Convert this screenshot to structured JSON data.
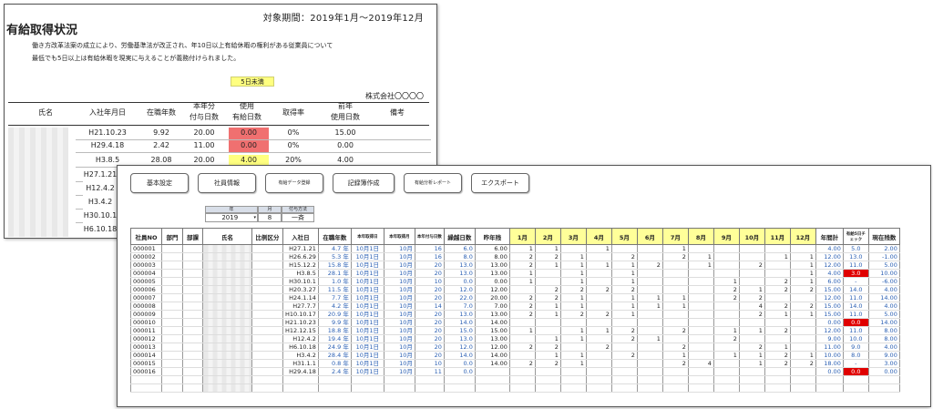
{
  "back_sheet": {
    "period": "対象期間：2019年1月～2019年12月",
    "title": "有給取得状況",
    "notice1": "働き方改革法案の成立により、労働基準法が改正され、年10日以上有給休暇の権利がある従業員について",
    "notice2": "最低でも5日以上は有給休暇を現実に与えることが義務付けられました。",
    "legend": "5日未満",
    "company": "株式会社〇〇〇〇",
    "headers": {
      "name": "氏名",
      "hire": "入社年月日",
      "tenure": "在職年数",
      "grant1": "本年分",
      "grant2": "付与日数",
      "used1": "使用",
      "used2": "有給日数",
      "rate": "取得率",
      "prev1": "前年",
      "prev2": "使用日数",
      "remarks": "備考"
    },
    "rows": [
      {
        "hire": "H21.10.23",
        "tenure": "9.92",
        "grant": "20.00",
        "used": "0.00",
        "rate": "0%",
        "prev": "15.00"
      },
      {
        "hire": "H29.4.18",
        "tenure": "2.42",
        "grant": "11.00",
        "used": "0.00",
        "rate": "0%",
        "prev": "0.00"
      },
      {
        "hire": "H3.8.5",
        "tenure": "28.08",
        "grant": "20.00",
        "used": "4.00",
        "rate": "20%",
        "prev": "4.00"
      },
      {
        "hire": "H27.1.21"
      },
      {
        "hire": "H12.4.2"
      },
      {
        "hire": "H3.4.2"
      },
      {
        "hire": "H30.10.1"
      },
      {
        "hire": "H6.10.18"
      }
    ]
  },
  "front_sheet": {
    "buttons": [
      "基本設定",
      "社員情報",
      "有給データ登録",
      "記録簿作成",
      "有給分析レポート",
      "エクスポート"
    ],
    "selector": {
      "year_label": "年",
      "month_label": "月",
      "method_label": "付与方法",
      "year": "2019",
      "month": "8",
      "method": "一斉"
    },
    "headers": {
      "no": "社員NO",
      "dept": "部門",
      "section": "部課",
      "name": "氏名",
      "ratio": "比例区分",
      "hire": "入社日",
      "tenure": "在職年数",
      "grant_date": "本年取得日",
      "grant_month": "本年取得月",
      "grant_days": "本年付与日数",
      "carry": "繰越日数",
      "prev": "昨年残",
      "months": [
        "1月",
        "2月",
        "3月",
        "4月",
        "5月",
        "6月",
        "7月",
        "8月",
        "9月",
        "10月",
        "11月",
        "12月"
      ],
      "total": "年間計",
      "check": "有給5日チェック",
      "remain": "現在残数"
    },
    "rows": [
      {
        "no": "000001",
        "hire": "H27.1.21",
        "tenure": "4.7 年",
        "gdate": "10月1日",
        "gmonth": "10月",
        "gdays": "16",
        "carry": "6.0",
        "prev": "6.00",
        "m": [
          "1",
          "1",
          "",
          "1",
          "",
          "",
          "1",
          "",
          "",
          "",
          "",
          ""
        ],
        "total": "4.00",
        "check": "5.0",
        "remain": "2.00"
      },
      {
        "no": "000002",
        "hire": "H26.6.29",
        "tenure": "5.3 年",
        "gdate": "10月1日",
        "gmonth": "10月",
        "gdays": "16",
        "carry": "8.0",
        "prev": "8.00",
        "m": [
          "2",
          "2",
          "1",
          "",
          "2",
          "",
          "2",
          "1",
          "",
          "",
          "1",
          "1"
        ],
        "total": "12.00",
        "check": "13.0",
        "remain": "-1.00"
      },
      {
        "no": "000003",
        "hire": "H15.12.2",
        "tenure": "15.8 年",
        "gdate": "10月1日",
        "gmonth": "10月",
        "gdays": "20",
        "carry": "13.0",
        "prev": "13.00",
        "m": [
          "2",
          "1",
          "1",
          "1",
          "1",
          "2",
          "",
          "1",
          "",
          "2",
          "",
          "1"
        ],
        "total": "12.00",
        "check": "11.0",
        "remain": "5.00"
      },
      {
        "no": "000004",
        "hire": "H3.8.5",
        "tenure": "28.1 年",
        "gdate": "10月1日",
        "gmonth": "10月",
        "gdays": "20",
        "carry": "13.0",
        "prev": "13.00",
        "m": [
          "1",
          "",
          "1",
          "",
          "1",
          "",
          "",
          "",
          "",
          "",
          "",
          "1"
        ],
        "total": "4.00",
        "check": "3.0",
        "remain": "10.00",
        "red": true
      },
      {
        "no": "000005",
        "hire": "H30.10.1",
        "tenure": "1.0 年",
        "gdate": "10月1日",
        "gmonth": "10月",
        "gdays": "10",
        "carry": "0.0",
        "prev": "0.00",
        "m": [
          "1",
          "",
          "1",
          "",
          "1",
          "",
          "",
          "",
          "1",
          "",
          "2",
          "1"
        ],
        "total": "6.00",
        "check": "-",
        "remain": "-6.00"
      },
      {
        "no": "000006",
        "hire": "H20.3.27",
        "tenure": "11.5 年",
        "gdate": "10月1日",
        "gmonth": "10月",
        "gdays": "20",
        "carry": "12.0",
        "prev": "12.00",
        "m": [
          "",
          "2",
          "2",
          "2",
          "2",
          "",
          "",
          "",
          "2",
          "1",
          "2",
          "2"
        ],
        "total": "15.00",
        "check": "14.0",
        "remain": "4.00"
      },
      {
        "no": "000007",
        "hire": "H24.1.14",
        "tenure": "7.7 年",
        "gdate": "10月1日",
        "gmonth": "10月",
        "gdays": "20",
        "carry": "22.0",
        "prev": "20.00",
        "m": [
          "2",
          "2",
          "1",
          "",
          "1",
          "1",
          "1",
          "",
          "2",
          "2",
          "",
          ""
        ],
        "total": "12.00",
        "check": "11.0",
        "remain": "14.00"
      },
      {
        "no": "000008",
        "hire": "H27.7.7",
        "tenure": "4.2 年",
        "gdate": "10月1日",
        "gmonth": "10月",
        "gdays": "14",
        "carry": "7.0",
        "prev": "7.00",
        "m": [
          "2",
          "1",
          "1",
          "",
          "1",
          "1",
          "1",
          "",
          "",
          "4",
          "2",
          "2"
        ],
        "total": "15.00",
        "check": "14.0",
        "remain": "4.00"
      },
      {
        "no": "000009",
        "hire": "H10.10.17",
        "tenure": "20.9 年",
        "gdate": "10月1日",
        "gmonth": "10月",
        "gdays": "20",
        "carry": "13.0",
        "prev": "13.00",
        "m": [
          "2",
          "1",
          "2",
          "2",
          "1",
          "",
          "",
          "",
          "",
          "2",
          "1",
          "1"
        ],
        "total": "15.00",
        "check": "11.0",
        "remain": "5.00"
      },
      {
        "no": "000010",
        "hire": "H21.10.23",
        "tenure": "9.9 年",
        "gdate": "10月1日",
        "gmonth": "10月",
        "gdays": "20",
        "carry": "14.0",
        "prev": "14.00",
        "m": [
          "",
          "",
          "",
          "",
          "",
          "",
          "",
          "",
          "",
          "",
          "",
          ""
        ],
        "total": "0.00",
        "check": "0.0",
        "remain": "14.00",
        "red": true
      },
      {
        "no": "000011",
        "hire": "H12.12.15",
        "tenure": "18.8 年",
        "gdate": "10月1日",
        "gmonth": "10月",
        "gdays": "20",
        "carry": "15.0",
        "prev": "15.00",
        "m": [
          "1",
          "",
          "1",
          "1",
          "2",
          "",
          "2",
          "",
          "1",
          "1",
          "2",
          ""
        ],
        "total": "12.00",
        "check": "11.0",
        "remain": "8.00"
      },
      {
        "no": "000012",
        "hire": "H12.4.2",
        "tenure": "19.4 年",
        "gdate": "10月1日",
        "gmonth": "10月",
        "gdays": "20",
        "carry": "13.0",
        "prev": "13.00",
        "m": [
          "",
          "1",
          "1",
          "",
          "2",
          "1",
          "",
          "",
          "2",
          "",
          "",
          ""
        ],
        "total": "9.00",
        "check": "10.0",
        "remain": "8.00"
      },
      {
        "no": "000013",
        "hire": "H6.10.18",
        "tenure": "24.9 年",
        "gdate": "10月1日",
        "gmonth": "10月",
        "gdays": "20",
        "carry": "12.0",
        "prev": "12.00",
        "m": [
          "2",
          "2",
          "",
          "2",
          "",
          "",
          "2",
          "",
          "",
          "2",
          "1",
          ""
        ],
        "total": "11.00",
        "check": "9.0",
        "remain": "4.00"
      },
      {
        "no": "000014",
        "hire": "H3.4.2",
        "tenure": "28.4 年",
        "gdate": "10月1日",
        "gmonth": "10月",
        "gdays": "20",
        "carry": "14.0",
        "prev": "14.00",
        "m": [
          "",
          "1",
          "1",
          "",
          "2",
          "",
          "1",
          "",
          "1",
          "1",
          "2",
          "1"
        ],
        "total": "10.00",
        "check": "8.0",
        "remain": "9.00"
      },
      {
        "no": "000015",
        "hire": "H31.1.1",
        "tenure": "0.8 年",
        "gdate": "10月1日",
        "gmonth": "10月",
        "gdays": "10",
        "carry": "0.0",
        "prev": "14.00",
        "m": [
          "2",
          "2",
          "1",
          "",
          "",
          "",
          "2",
          "4",
          "",
          "1",
          "2",
          "2"
        ],
        "total": "18.00",
        "check": "-",
        "remain": "3.00"
      },
      {
        "no": "000016",
        "hire": "H29.4.18",
        "tenure": "2.4 年",
        "gdate": "10月1日",
        "gmonth": "10月",
        "gdays": "11",
        "carry": "0.0",
        "prev": "",
        "m": [
          "",
          "",
          "",
          "",
          "",
          "",
          "",
          "",
          "",
          "",
          "",
          ""
        ],
        "total": "0.00",
        "check": "0.0",
        "remain": "0.00",
        "red": true
      }
    ]
  }
}
